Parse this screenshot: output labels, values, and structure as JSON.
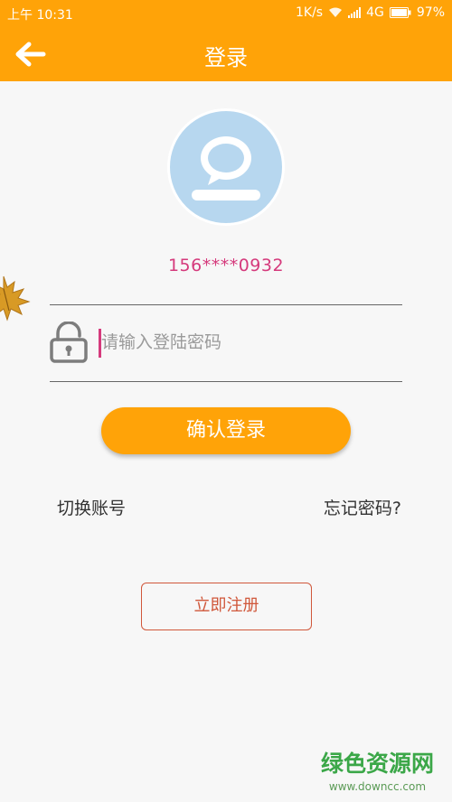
{
  "status_bar": {
    "time": "上午 10:31",
    "speed": "1K/s",
    "network": "4G",
    "battery": "97%"
  },
  "header": {
    "title": "登录",
    "back_icon": "arrow-left-icon"
  },
  "colors": {
    "primary": "#ffa308",
    "accent": "#d53a7c",
    "register": "#d0573a",
    "avatar_bg": "#b7d7ef"
  },
  "account": {
    "phone": "156****0932",
    "avatar_icon": "chat-bubble-user-icon"
  },
  "password": {
    "placeholder": "请输入登陆密码",
    "value": "",
    "icon": "lock-icon"
  },
  "actions": {
    "confirm_login": "确认登录",
    "switch_account": "切换账号",
    "forgot_password": "忘记密码?",
    "register_now": "立即注册"
  },
  "watermark": {
    "title": "绿色资源网",
    "url": "www.downcc.com"
  }
}
